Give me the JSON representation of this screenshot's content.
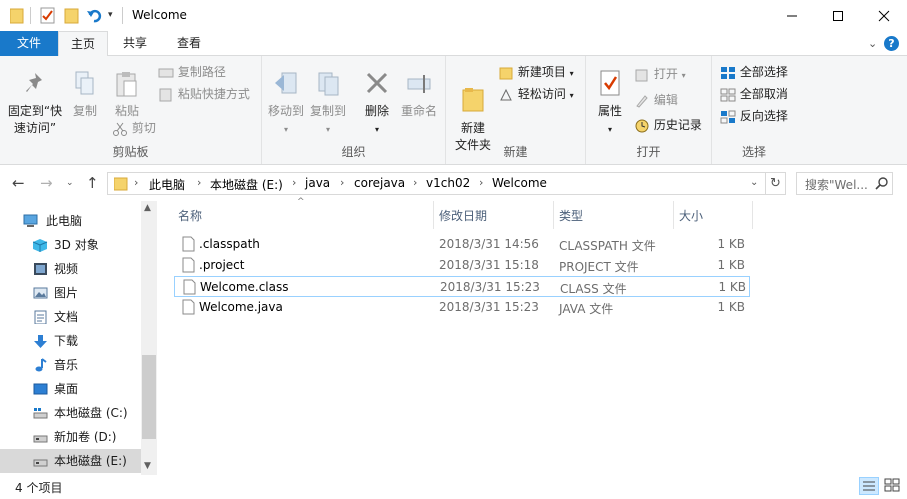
{
  "window": {
    "title": "Welcome",
    "minimize_icon": "minimize-icon",
    "maximize_icon": "maximize-icon",
    "close_icon": "close-icon"
  },
  "tabs": {
    "file": "文件",
    "home": "主页",
    "share": "共享",
    "view": "查看"
  },
  "ribbon": {
    "clipboard": {
      "label": "剪贴板",
      "pin": "固定到“快速访问”",
      "copy": "复制",
      "paste": "粘贴",
      "copy_path": "复制路径",
      "paste_shortcut": "粘贴快捷方式",
      "cut": "剪切"
    },
    "organize": {
      "label": "组织",
      "move_to": "移动到",
      "copy_to": "复制到",
      "delete": "删除",
      "rename": "重命名"
    },
    "new": {
      "label": "新建",
      "new_folder": "新建\n文件夹",
      "new_item": "新建项目",
      "easy_access": "轻松访问"
    },
    "open": {
      "label": "打开",
      "properties": "属性",
      "open": "打开",
      "edit": "编辑",
      "history": "历史记录"
    },
    "select": {
      "label": "选择",
      "select_all": "全部选择",
      "select_none": "全部取消",
      "invert": "反向选择"
    }
  },
  "address": {
    "crumbs": [
      "此电脑",
      "本地磁盘 (E:)",
      "java",
      "corejava",
      "v1ch02",
      "Welcome"
    ],
    "search_placeholder": "搜索\"Wel..."
  },
  "nav": {
    "items": [
      {
        "label": "此电脑",
        "icon": "computer-icon"
      },
      {
        "label": "3D 对象",
        "icon": "3d-objects-icon"
      },
      {
        "label": "视频",
        "icon": "video-icon"
      },
      {
        "label": "图片",
        "icon": "pictures-icon"
      },
      {
        "label": "文档",
        "icon": "documents-icon"
      },
      {
        "label": "下载",
        "icon": "download-icon"
      },
      {
        "label": "音乐",
        "icon": "music-icon"
      },
      {
        "label": "桌面",
        "icon": "desktop-icon"
      },
      {
        "label": "本地磁盘 (C:)",
        "icon": "drive-icon"
      },
      {
        "label": "新加卷 (D:)",
        "icon": "drive-icon"
      },
      {
        "label": "本地磁盘 (E:)",
        "icon": "drive-icon"
      }
    ]
  },
  "list": {
    "columns": {
      "name": "名称",
      "date": "修改日期",
      "type": "类型",
      "size": "大小"
    },
    "files": [
      {
        "name": ".classpath",
        "date": "2018/3/31 14:56",
        "type": "CLASSPATH 文件",
        "size": "1 KB"
      },
      {
        "name": ".project",
        "date": "2018/3/31 15:18",
        "type": "PROJECT 文件",
        "size": "1 KB"
      },
      {
        "name": "Welcome.class",
        "date": "2018/3/31 15:23",
        "type": "CLASS 文件",
        "size": "1 KB"
      },
      {
        "name": "Welcome.java",
        "date": "2018/3/31 15:23",
        "type": "JAVA 文件",
        "size": "1 KB"
      }
    ]
  },
  "status": {
    "count": "4 个项目"
  },
  "colors": {
    "accent": "#1979ca",
    "selection": "#cce8ff",
    "selection_border": "#99d1ff"
  }
}
